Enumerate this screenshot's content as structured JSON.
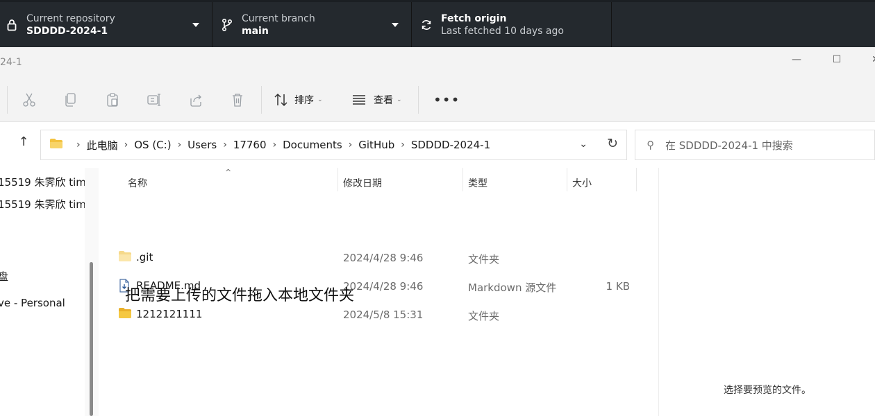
{
  "github": {
    "repo_caption": "Current repository",
    "repo_name": "SDDDD-2024-1",
    "branch_caption": "Current branch",
    "branch_name": "main",
    "fetch_title": "Fetch origin",
    "fetch_status": "Last fetched 10 days ago",
    "icons": {
      "repo": "lock-icon",
      "branch": "branch-icon",
      "fetch": "sync-icon"
    }
  },
  "window": {
    "title": "24-1"
  },
  "toolbar": {
    "sort_label": "排序",
    "view_label": "查看",
    "more_label": "•••",
    "icons": [
      "cut-icon",
      "copy-icon",
      "paste-icon",
      "rename-icon",
      "share-icon",
      "delete-icon"
    ]
  },
  "address": {
    "crumbs": [
      "此电脑",
      "OS (C:)",
      "Users",
      "17760",
      "Documents",
      "GitHub",
      "SDDDD-2024-1"
    ],
    "search_placeholder": "在 SDDDD-2024-1 中搜索"
  },
  "nav": {
    "items": [
      "15519 朱霁欣 tim",
      "15519 朱霁欣 tim",
      "盘",
      "ve - Personal"
    ]
  },
  "columns": {
    "name": "名称",
    "date": "修改日期",
    "type": "类型",
    "size": "大小"
  },
  "files": [
    {
      "name": ".git",
      "date": "2024/4/28 9:46",
      "type": "文件夹",
      "size": "",
      "kind": "folder-faded"
    },
    {
      "name": "README.md",
      "date": "2024/4/28 9:46",
      "type": "Markdown 源文件",
      "size": "1 KB",
      "kind": "file"
    },
    {
      "name": "1212121111",
      "date": "2024/5/8 15:31",
      "type": "文件夹",
      "size": "",
      "kind": "folder"
    }
  ],
  "annotation": "把需要上传的文件拖入本地文件夹",
  "preview": {
    "empty_text": "选择要预览的文件。"
  },
  "colors": {
    "gh_bg": "#24292e",
    "folder": "#f0c040",
    "accent": "#0067c0"
  }
}
